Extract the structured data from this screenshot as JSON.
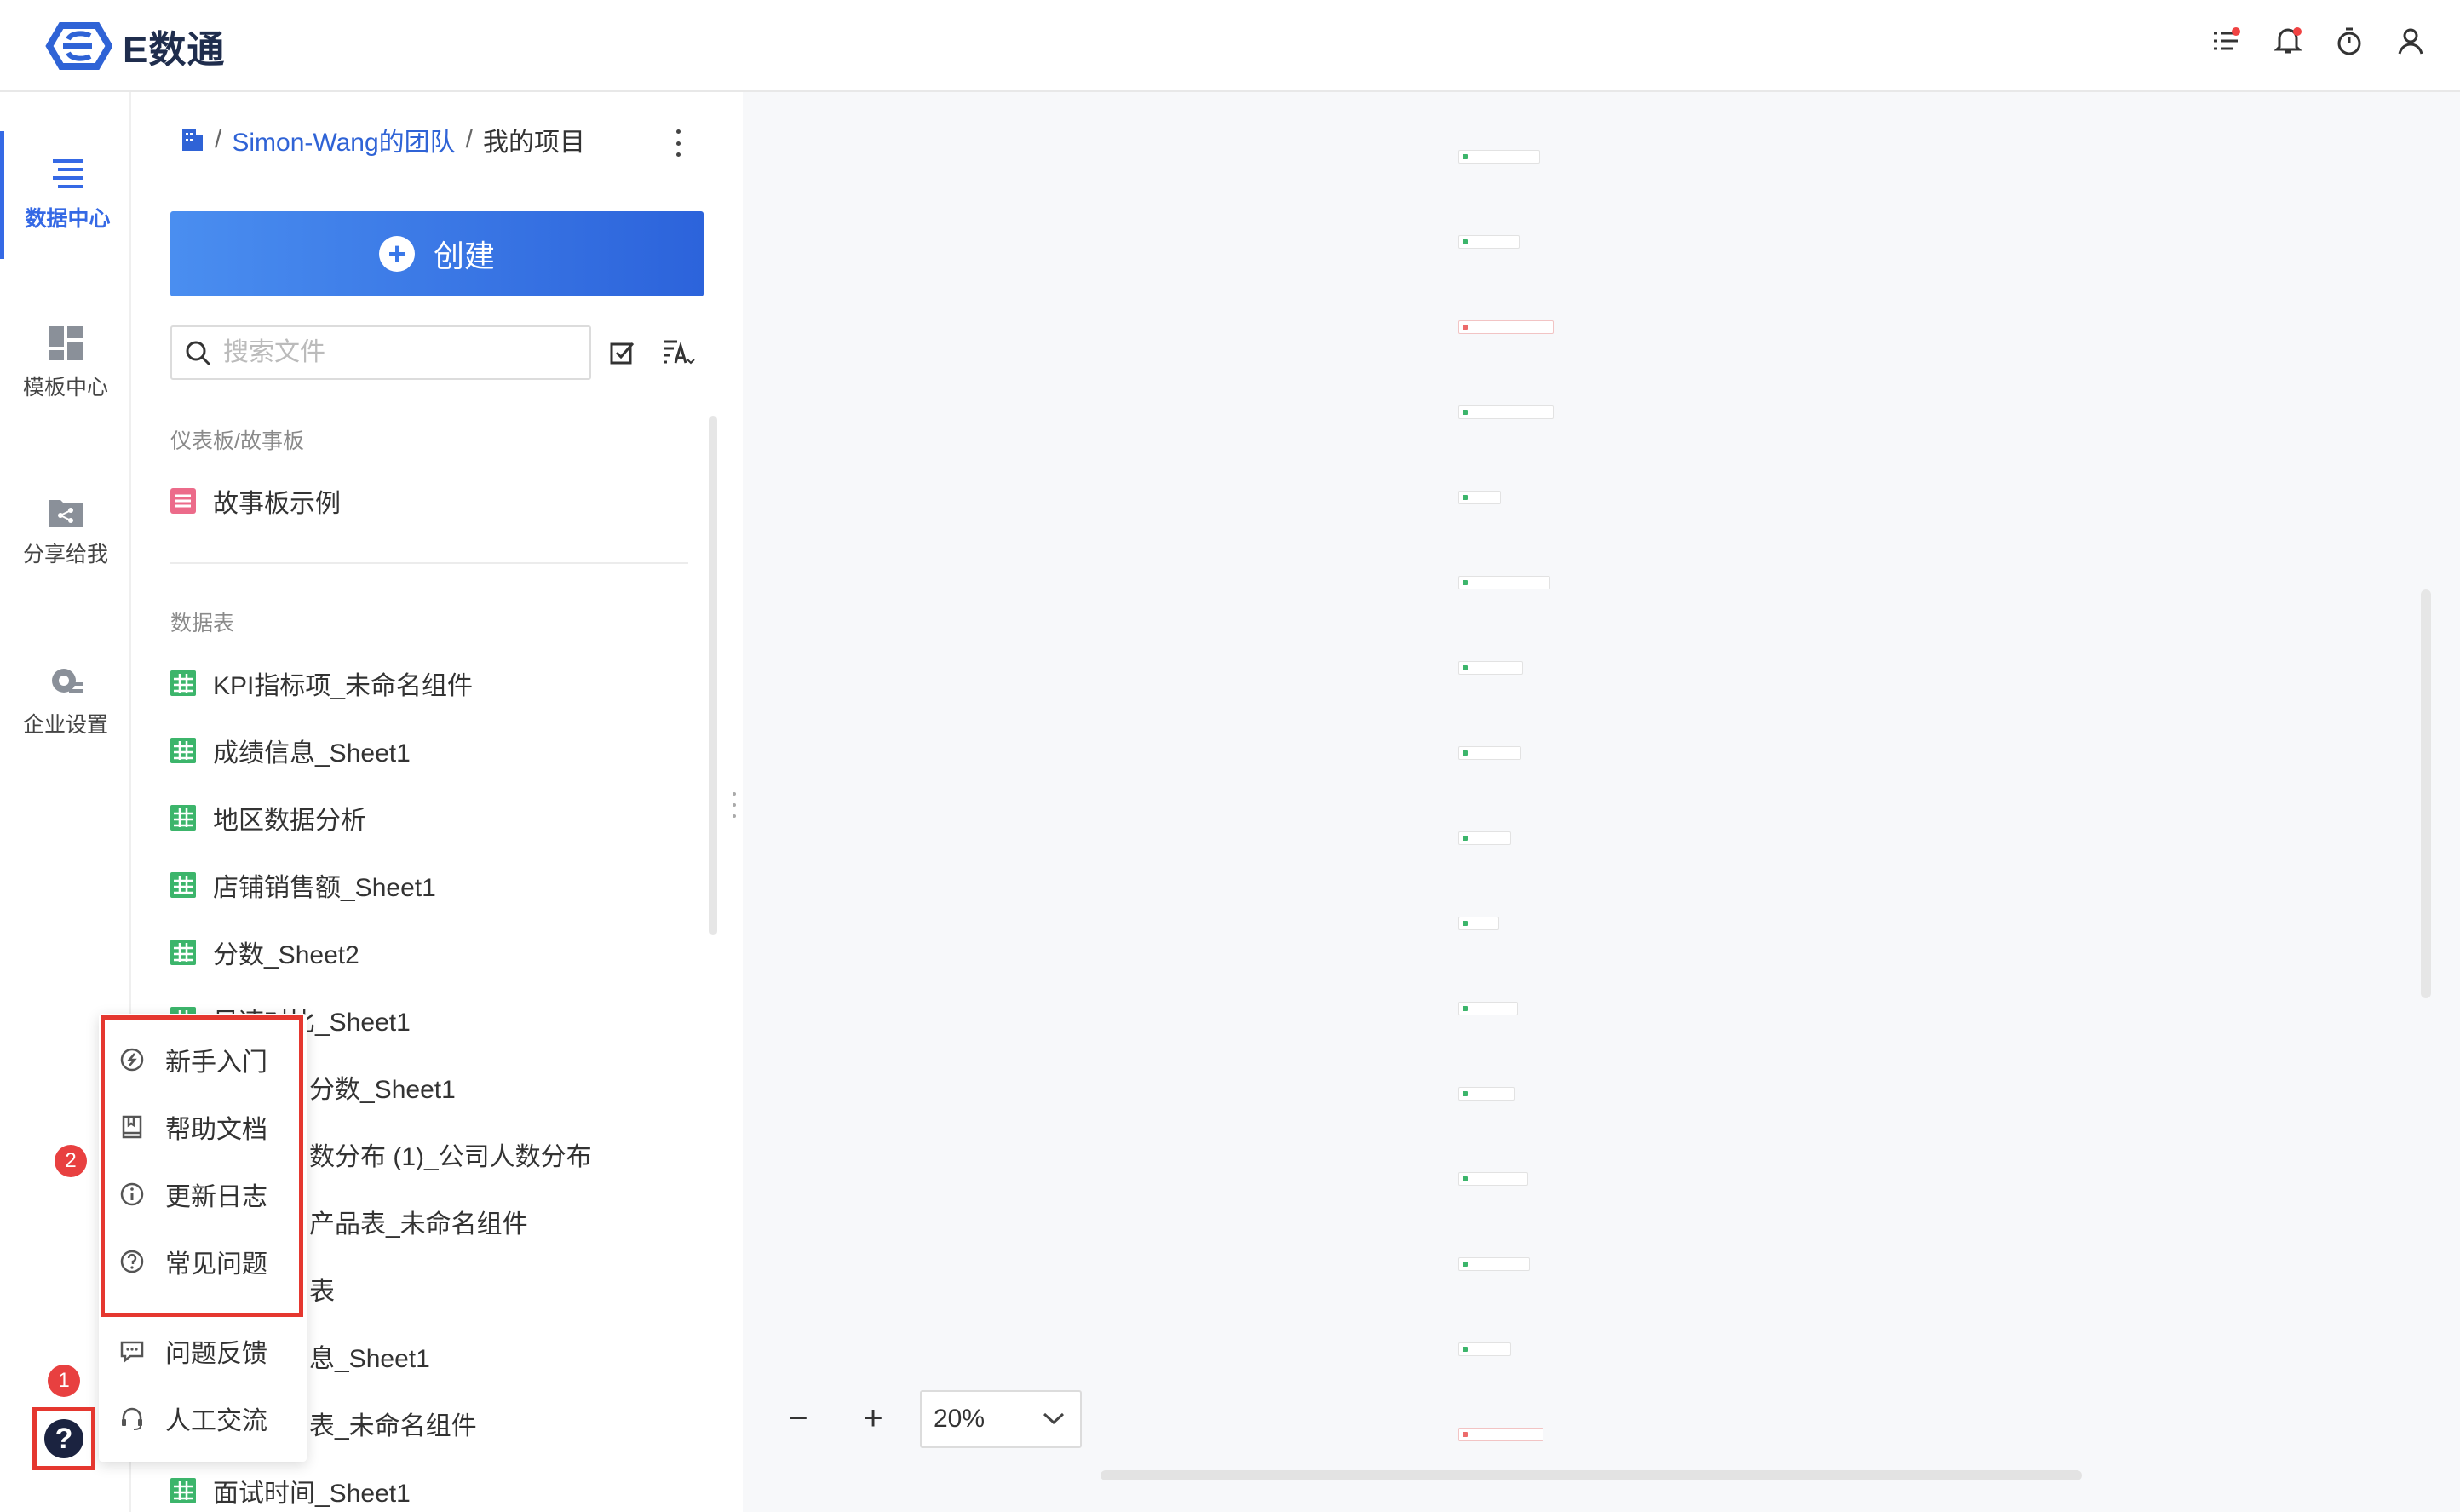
{
  "app": {
    "name": "E数通"
  },
  "topbar": {
    "icons": [
      "task-list-icon",
      "bell-icon",
      "timer-icon",
      "user-icon"
    ]
  },
  "nav": {
    "items": [
      {
        "label": "数据中心",
        "active": true,
        "icon": "data-center-icon"
      },
      {
        "label": "模板中心",
        "active": false,
        "icon": "template-icon"
      },
      {
        "label": "分享给我",
        "active": false,
        "icon": "share-folder-icon"
      },
      {
        "label": "企业设置",
        "active": false,
        "icon": "gear-icon"
      }
    ]
  },
  "panel": {
    "breadcrumb": {
      "team": "Simon-Wang的团队",
      "current": "我的项目"
    },
    "create_label": "创建",
    "search_placeholder": "搜索文件",
    "dashboard_section": "仪表板/故事板",
    "dashboards": [
      "故事板示例"
    ],
    "table_section": "数据表",
    "tables": [
      "KPI指标项_未命名组件",
      "成绩信息_Sheet1",
      "地区数据分析",
      "店铺销售额_Sheet1",
      "分数_Sheet2",
      "风速对比_Sheet1",
      "分数_Sheet1",
      "数分布 (1)_公司人数分布",
      "产品表_未命名组件",
      "表",
      "息_Sheet1",
      "表_未命名组件",
      "面试时间_Sheet1"
    ]
  },
  "canvas": {
    "zoom": "20%",
    "zoom_minus": "−",
    "zoom_plus": "+"
  },
  "help_menu": {
    "items": [
      "新手入门",
      "帮助文档",
      "更新日志",
      "常见问题",
      "问题反馈",
      "人工交流"
    ],
    "badge1": "1",
    "badge2": "2",
    "help_glyph": "?"
  },
  "colors": {
    "accent": "#3569e5",
    "highlight": "#e5372f",
    "sheet_green": "#3cb56b",
    "story_pink": "#ec6b8a"
  }
}
